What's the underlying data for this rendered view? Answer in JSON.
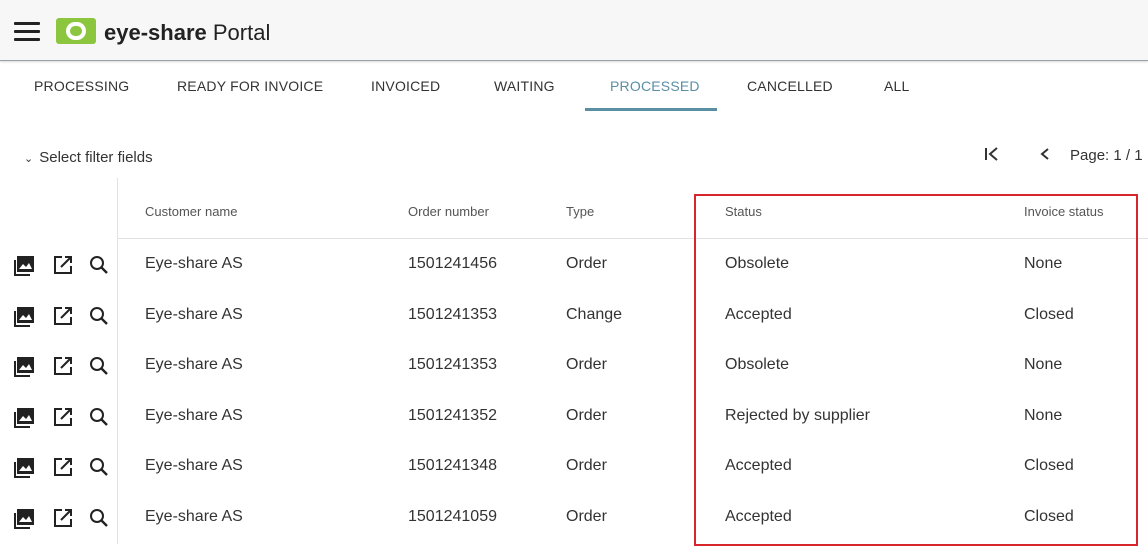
{
  "header": {
    "brand_bold": "eye-share",
    "brand_rest": " Portal"
  },
  "tabs": [
    {
      "label": "PROCESSING"
    },
    {
      "label": "READY FOR INVOICE"
    },
    {
      "label": "INVOICED"
    },
    {
      "label": "WAITING"
    },
    {
      "label": "PROCESSED",
      "active": true
    },
    {
      "label": "CANCELLED"
    },
    {
      "label": "ALL"
    }
  ],
  "filter": {
    "label": "Select filter fields"
  },
  "pagination": {
    "first_icon": "first-page-icon",
    "prev_icon": "prev-page-icon",
    "label": "Page: 1 / 1"
  },
  "table": {
    "columns": [
      "Customer name",
      "Order number",
      "Type",
      "Status",
      "Invoice status"
    ],
    "rows": [
      {
        "customer": "Eye-share AS",
        "order": "1501241456",
        "type": "Order",
        "status": "Obsolete",
        "invoice_status": "None"
      },
      {
        "customer": "Eye-share AS",
        "order": "1501241353",
        "type": "Change",
        "status": "Accepted",
        "invoice_status": "Closed"
      },
      {
        "customer": "Eye-share AS",
        "order": "1501241353",
        "type": "Order",
        "status": "Obsolete",
        "invoice_status": "None"
      },
      {
        "customer": "Eye-share AS",
        "order": "1501241352",
        "type": "Order",
        "status": "Rejected by supplier",
        "invoice_status": "None"
      },
      {
        "customer": "Eye-share AS",
        "order": "1501241348",
        "type": "Order",
        "status": "Accepted",
        "invoice_status": "Closed"
      },
      {
        "customer": "Eye-share AS",
        "order": "1501241059",
        "type": "Order",
        "status": "Accepted",
        "invoice_status": "Closed"
      }
    ],
    "row_icons": [
      "image-icon",
      "open-external-icon",
      "search-icon"
    ]
  },
  "colors": {
    "accent": "#5a8fa3",
    "logo_green": "#8cc63f",
    "highlight_red": "#d6262b"
  }
}
